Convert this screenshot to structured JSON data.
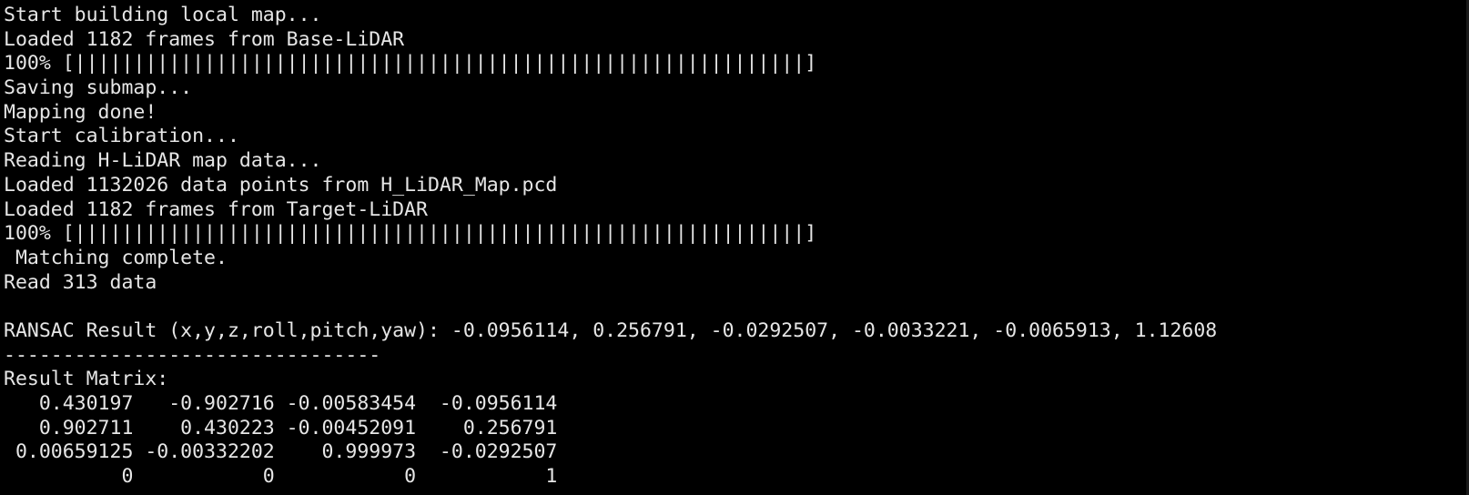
{
  "terminal": {
    "lines": [
      "Start building local map...",
      "Loaded 1182 frames from Base-LiDAR",
      "100% [||||||||||||||||||||||||||||||||||||||||||||||||||||||||||||||]",
      "Saving submap...",
      "Mapping done!",
      "Start calibration...",
      "Reading H-LiDAR map data...",
      "Loaded 1132026 data points from H_LiDAR_Map.pcd",
      "Loaded 1182 frames from Target-LiDAR",
      "100% [||||||||||||||||||||||||||||||||||||||||||||||||||||||||||||||]",
      " Matching complete.",
      "Read 313 data",
      "",
      "RANSAC Result (x,y,z,roll,pitch,yaw): -0.0956114, 0.256791, -0.0292507, -0.0033221, -0.0065913, 1.12608",
      "--------------------------------",
      "Result Matrix:",
      "   0.430197   -0.902716 -0.00583454  -0.0956114",
      "   0.902711    0.430223 -0.00452091    0.256791",
      " 0.00659125 -0.00332202    0.999973  -0.0292507",
      "          0           0           0           1"
    ]
  },
  "colors": {
    "background": "#000000",
    "text": "#e6e6e6"
  }
}
